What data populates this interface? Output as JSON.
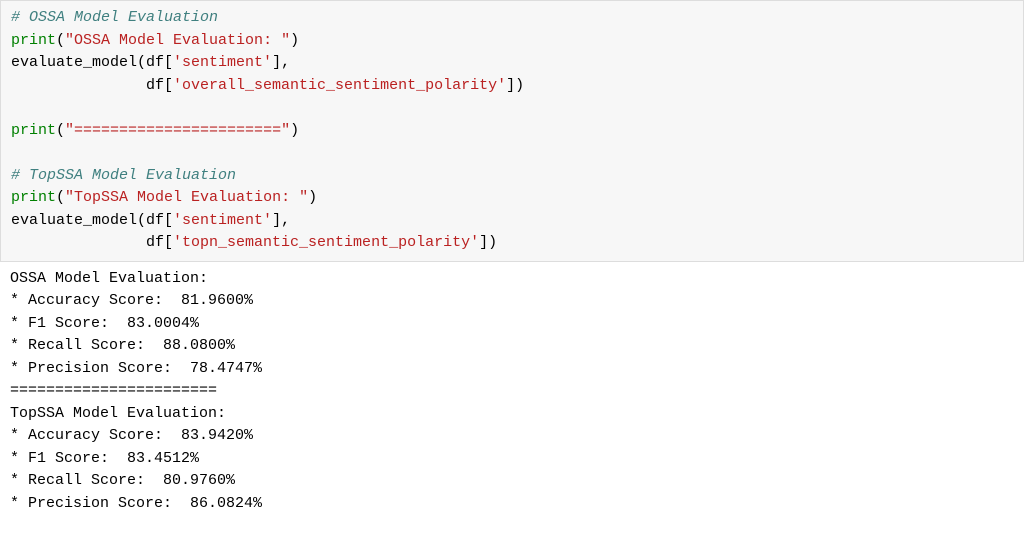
{
  "code": {
    "comment1": "# OSSA Model Evaluation",
    "print_fn": "print",
    "lp": "(",
    "rp": ")",
    "str1": "\"OSSA Model Evaluation: \"",
    "eval_fn": "evaluate_model",
    "df_open": "(df[",
    "sent_key": "'sentiment'",
    "close_br_comma": "],",
    "indent1": "               df[",
    "ossa_key": "'overall_semantic_sentiment_polarity'",
    "close_br_rp": "])",
    "blank": "",
    "str_sep": "\"=======================\"",
    "comment2": "# TopSSA Model Evaluation",
    "str2": "\"TopSSA Model Evaluation: \"",
    "topssa_key": "'topn_semantic_sentiment_polarity'"
  },
  "output": {
    "l1": "OSSA Model Evaluation: ",
    "l2": "* Accuracy Score:  81.9600%",
    "l3": "* F1 Score:  83.0004%",
    "l4": "* Recall Score:  88.0800%",
    "l5": "* Precision Score:  78.4747%",
    "l6": "=======================",
    "l7": "TopSSA Model Evaluation: ",
    "l8": "* Accuracy Score:  83.9420%",
    "l9": "* F1 Score:  83.4512%",
    "l10": "* Recall Score:  80.9760%",
    "l11": "* Precision Score:  86.0824%"
  }
}
